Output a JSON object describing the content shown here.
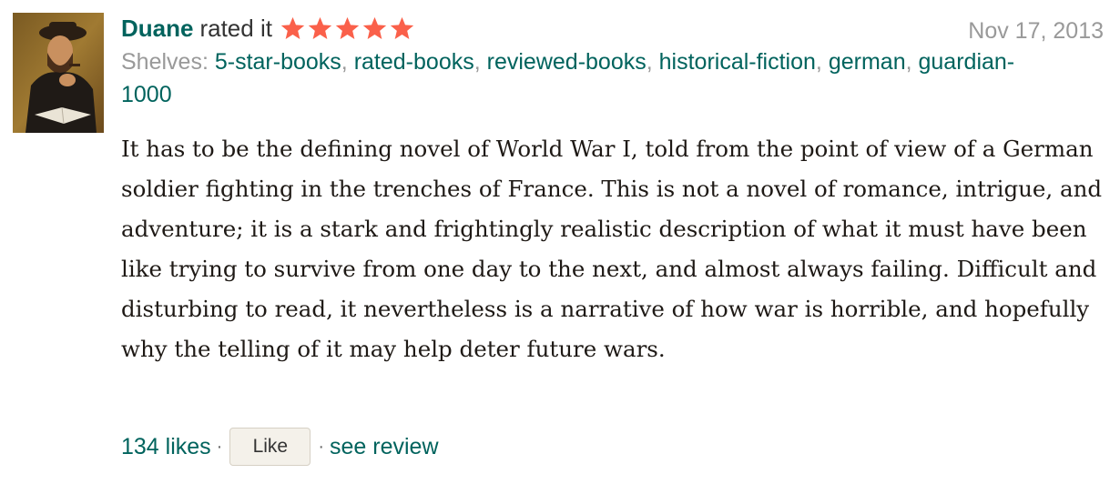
{
  "review": {
    "reviewer_name": "Duane",
    "rated_text": "rated it",
    "rating": 5,
    "rating_max": 5,
    "star_color": "#fa604a",
    "date": "Nov 17, 2013",
    "avatar_icon": "reviewer-portrait-painting",
    "shelves": {
      "label": "Shelves:",
      "items": [
        "5-star-books",
        "rated-books",
        "reviewed-books",
        "historical-fiction",
        "german",
        "guardian-1000"
      ]
    },
    "text": "It has to be the defining novel of World War I, told from the point of view of a German soldier fighting in the trenches of France. This is not a novel of romance, intrigue, and adventure; it is a stark and frightingly realistic description of what it must have been like trying to survive from one day to the next, and almost always failing. Difficult and disturbing to read, it nevertheless is a narrative of how war is horrible, and hopefully why the telling of it may help deter future wars.",
    "footer": {
      "likes": "134 likes",
      "separator": "·",
      "like_button": "Like",
      "see_review": "see review"
    }
  },
  "colors": {
    "link": "#00635d",
    "muted": "#999999",
    "like_button_bg": "#f4f1ea"
  }
}
